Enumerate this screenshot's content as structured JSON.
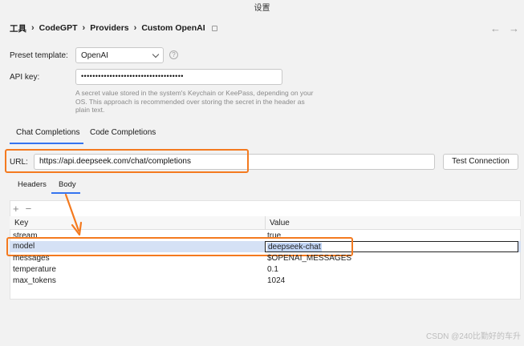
{
  "window": {
    "title": "设置"
  },
  "breadcrumb": {
    "items": [
      "工具",
      "CodeGPT",
      "Providers",
      "Custom OpenAI"
    ],
    "separator": "›"
  },
  "nav": {
    "back": "←",
    "forward": "→"
  },
  "form": {
    "preset_label": "Preset template:",
    "preset_value": "OpenAI",
    "help_glyph": "?",
    "apikey_label": "API key:",
    "apikey_value": "••••••••••••••••••••••••••••••••••••",
    "apikey_hint": "A secret value stored in the system's Keychain or KeePass, depending on your OS. This approach is recommended over storing the secret in the header as plain text."
  },
  "tabs": {
    "chat": "Chat Completions",
    "code": "Code Completions",
    "active": "chat"
  },
  "url": {
    "label": "URL:",
    "value": "https://api.deepseek.com/chat/completions",
    "test_button": "Test Connection"
  },
  "subtabs": {
    "headers": "Headers",
    "body": "Body",
    "active": "body"
  },
  "table": {
    "add": "+",
    "remove": "−",
    "col_key": "Key",
    "col_value": "Value",
    "rows": [
      {
        "key": "stream",
        "value": "true"
      },
      {
        "key": "model",
        "value": "deepseek-chat"
      },
      {
        "key": "messages",
        "value": "$OPENAI_MESSAGES"
      },
      {
        "key": "temperature",
        "value": "0.1"
      },
      {
        "key": "max_tokens",
        "value": "1024"
      }
    ]
  },
  "colors": {
    "accent": "#3574f0",
    "highlight": "#f47a1f",
    "selection": "#d5e1f5"
  },
  "watermark": "CSDN @240比勤好的车升"
}
